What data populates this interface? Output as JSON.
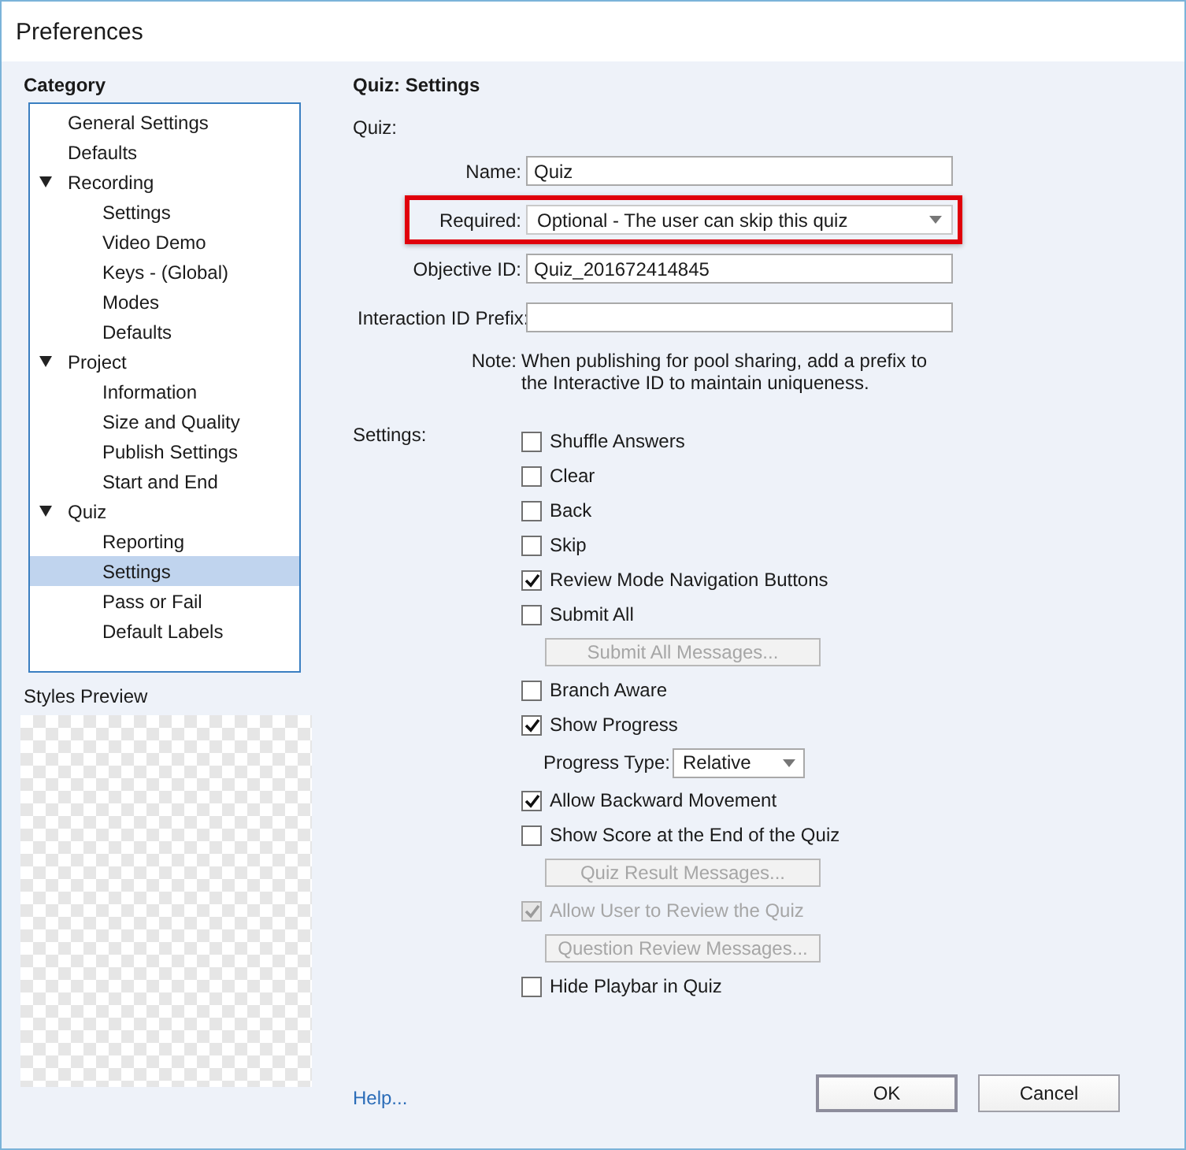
{
  "window": {
    "title": "Preferences"
  },
  "category": {
    "title": "Category",
    "items": [
      {
        "label": "General Settings",
        "selected": false
      },
      {
        "label": "Defaults",
        "selected": false
      },
      {
        "label": "Recording",
        "selected": false,
        "expanded": true,
        "children": [
          {
            "label": "Settings",
            "selected": false
          },
          {
            "label": "Video Demo",
            "selected": false
          },
          {
            "label": "Keys - (Global)",
            "selected": false
          },
          {
            "label": "Modes",
            "selected": false
          },
          {
            "label": "Defaults",
            "selected": false
          }
        ]
      },
      {
        "label": "Project",
        "selected": false,
        "expanded": true,
        "children": [
          {
            "label": "Information",
            "selected": false
          },
          {
            "label": "Size and Quality",
            "selected": false
          },
          {
            "label": "Publish Settings",
            "selected": false
          },
          {
            "label": "Start and End",
            "selected": false
          }
        ]
      },
      {
        "label": "Quiz",
        "selected": false,
        "expanded": true,
        "children": [
          {
            "label": "Reporting",
            "selected": false
          },
          {
            "label": "Settings",
            "selected": true
          },
          {
            "label": "Pass or Fail",
            "selected": false
          },
          {
            "label": "Default Labels",
            "selected": false
          }
        ]
      }
    ]
  },
  "styles_preview": {
    "label": "Styles Preview"
  },
  "panel": {
    "title": "Quiz: Settings",
    "section": "Quiz:",
    "fields": [
      {
        "kind": "text",
        "label": "Name:",
        "value": "Quiz",
        "highlighted": false
      },
      {
        "kind": "select",
        "label": "Required:",
        "value": "Optional - The user can skip this quiz",
        "highlighted": true
      },
      {
        "kind": "text",
        "label": "Objective ID:",
        "value": "Quiz_201672414845",
        "highlighted": false
      },
      {
        "kind": "text",
        "label": "Interaction ID Prefix:",
        "highlighted": false
      }
    ],
    "note": {
      "label": "Note:",
      "text": "When publishing for pool sharing, add a prefix to the Interactive ID to maintain uniqueness."
    },
    "settings_label": "Settings:",
    "settings": [
      {
        "kind": "checkbox",
        "label": "Shuffle Answers",
        "checked": false,
        "disabled": false
      },
      {
        "kind": "checkbox",
        "label": "Clear",
        "checked": false,
        "disabled": false
      },
      {
        "kind": "checkbox",
        "label": "Back",
        "checked": false,
        "disabled": false
      },
      {
        "kind": "checkbox",
        "label": "Skip",
        "checked": false,
        "disabled": false
      },
      {
        "kind": "checkbox",
        "label": "Review Mode Navigation Buttons",
        "checked": true,
        "disabled": false
      },
      {
        "kind": "checkbox",
        "label": "Submit All",
        "checked": false,
        "disabled": false
      },
      {
        "kind": "button",
        "label": "Submit All Messages...",
        "disabled": true
      },
      {
        "kind": "checkbox",
        "label": "Branch Aware",
        "checked": false,
        "disabled": false
      },
      {
        "kind": "checkbox",
        "label": "Show Progress",
        "checked": true,
        "disabled": false
      },
      {
        "kind": "select",
        "label": "Progress Type:",
        "value": "Relative"
      },
      {
        "kind": "checkbox",
        "label": "Allow Backward Movement",
        "checked": true,
        "disabled": false
      },
      {
        "kind": "checkbox",
        "label": "Show Score at the End of the Quiz",
        "checked": false,
        "disabled": false
      },
      {
        "kind": "button",
        "label": "Quiz Result Messages...",
        "disabled": true
      },
      {
        "kind": "checkbox",
        "label": "Allow User to Review the Quiz",
        "checked": true,
        "disabled": true
      },
      {
        "kind": "button",
        "label": "Question Review Messages...",
        "disabled": true
      },
      {
        "kind": "checkbox",
        "label": "Hide Playbar in Quiz",
        "checked": false,
        "disabled": false
      }
    ]
  },
  "help": "Help...",
  "buttons": [
    {
      "label": "OK",
      "default": true
    },
    {
      "label": "Cancel",
      "default": false
    }
  ]
}
